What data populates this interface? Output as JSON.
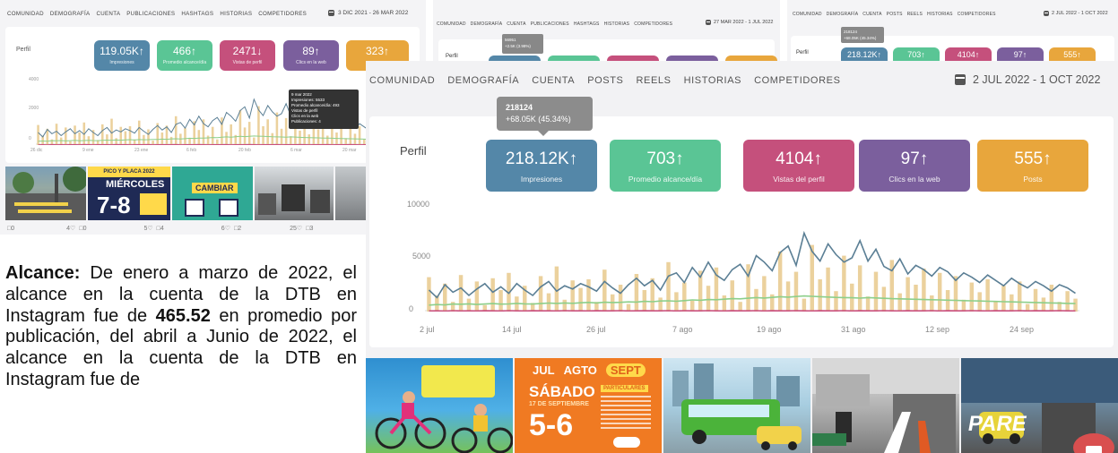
{
  "colors": {
    "blue": "#5487a8",
    "green": "#5ac595",
    "pink": "#c5507c",
    "purple": "#7b5f9d",
    "orange": "#e8a63c"
  },
  "panel1": {
    "nav": [
      "COMUNIDAD",
      "DEMOGRAFÍA",
      "CUENTA",
      "PUBLICACIONES",
      "HASHTAGS",
      "HISTORIAS",
      "COMPETIDORES"
    ],
    "date_range": "3 DIC 2021 - 26 MAR 2022",
    "perfil": "Perfil",
    "kpis": [
      {
        "value": "119.05K↑",
        "label": "Impresiones"
      },
      {
        "value": "466↑",
        "label": "Promedio alcance/día"
      },
      {
        "value": "2471↓",
        "label": "Vistas de perfil"
      },
      {
        "value": "89↑",
        "label": "Clics en la web"
      },
      {
        "value": "323↑",
        "label": ""
      }
    ],
    "y_ticks": [
      "4000",
      "2000",
      "0"
    ],
    "x_ticks": [
      "26 dic",
      "9 ene",
      "23 ene",
      "6 feb",
      "20 feb",
      "6 mar",
      "20 mar"
    ],
    "tooltip_title": "9 mar 2022",
    "tooltip_lines": [
      "Impresiones: 5533",
      "Promedio alcance/día: 493",
      "Vistas de perfil",
      "Clics en la web",
      "Publicaciones: 4"
    ],
    "post_stats": [
      "0",
      "4",
      "0",
      "5",
      "4",
      "6",
      "2",
      "25",
      "3"
    ],
    "post_thumb_texts": {
      "t2_title": "PICO Y PLACA 2022",
      "t2_day": "MIÉRCOLES",
      "t2_num": "7-8",
      "t3_word": "CAMBIAR"
    }
  },
  "panel2": {
    "nav": [
      "COMUNIDAD",
      "DEMOGRAFÍA",
      "CUENTA",
      "PUBLICACIONES",
      "HASHTAGS",
      "HISTORIAS",
      "COMPETIDORES"
    ],
    "date_range": "27 MAR 2022 - 1 JUL 2022",
    "tooltip": [
      "56951",
      "+2.5K (3.98%)"
    ],
    "perfil": "Perfil"
  },
  "panel3": {
    "nav": [
      "COMUNIDAD",
      "DEMOGRAFÍA",
      "CUENTA",
      "POSTS",
      "REELS",
      "HISTORIAS",
      "COMPETIDORES"
    ],
    "date_range": "2 JUL 2022 - 1 OCT 2022",
    "tooltip": [
      "218124",
      "+68.05K (45.34%)"
    ],
    "perfil": "Perfil",
    "kpis": [
      "218.12K↑",
      "703↑",
      "4104↑",
      "97↑",
      "555↑"
    ]
  },
  "panel4": {
    "nav": [
      "COMUNIDAD",
      "DEMOGRAFÍA",
      "CUENTA",
      "POSTS",
      "REELS",
      "HISTORIAS",
      "COMPETIDORES"
    ],
    "date_range": "2 JUL 2022 - 1 OCT 2022",
    "tooltip_value": "218124",
    "tooltip_delta": "+68.05K (45.34%)",
    "perfil": "Perfil",
    "kpis": [
      {
        "value": "218.12K↑",
        "label": "Impresiones"
      },
      {
        "value": "703↑",
        "label": "Promedio alcance/día"
      },
      {
        "value": "4104↑",
        "label": "Vistas del perfil"
      },
      {
        "value": "97↑",
        "label": "Clics en la web"
      },
      {
        "value": "555↑",
        "label": "Posts"
      }
    ],
    "y_ticks": [
      "10000",
      "5000",
      "0"
    ],
    "x_ticks": [
      "2 jul",
      "14 jul",
      "26 jul",
      "7 ago",
      "19 ago",
      "31 ago",
      "12 sep",
      "24 sep"
    ],
    "thumb_texts": {
      "t2_months": [
        "JUL",
        "AGTO",
        "SEPT"
      ],
      "t2_day": "SÁBADO",
      "t2_num": "5-6",
      "t2_sub": "17 DE SEPTIEMBRE",
      "t2_tag": "PARTICULARES",
      "t5_word": "PARE"
    }
  },
  "chart_data": {
    "type": "bar",
    "x": [
      "2 jul",
      "14 jul",
      "26 jul",
      "7 ago",
      "19 ago",
      "31 ago",
      "12 sep",
      "24 sep"
    ],
    "ylim": [
      0,
      10000
    ],
    "y_ticks": [
      0,
      5000,
      10000
    ],
    "series": [
      {
        "name": "",
        "kind": "bar",
        "color": "#e8c98c",
        "values": [
          3200,
          1500,
          2600,
          900,
          3400,
          1200,
          2800,
          600,
          3100,
          2000,
          3600,
          1400,
          2400,
          800,
          3300,
          1700,
          4200,
          1100,
          2900,
          2200,
          3000,
          900,
          3900,
          1600,
          2500,
          700,
          3500,
          2000,
          3100,
          1300,
          4600,
          1800,
          2700,
          1000,
          3800,
          2400,
          4100,
          1500,
          2900,
          900,
          4400,
          2100,
          3300,
          1600,
          5600,
          2800,
          3700,
          1200,
          6200,
          3000,
          4100,
          1900,
          5200,
          2600,
          4300,
          1400,
          3700,
          2300,
          4800,
          1700,
          3200,
          2500,
          4000,
          1500,
          3600,
          2000,
          3300,
          1100,
          2700,
          1800,
          3000,
          900,
          2400,
          1600,
          2800,
          700,
          2100,
          1300,
          2500,
          900,
          1900,
          1200
        ]
      },
      {
        "name": "",
        "kind": "line",
        "color": "#5b7f95",
        "values": [
          2000,
          1300,
          2500,
          1800,
          2200,
          1500,
          2100,
          2600,
          1800,
          2300,
          1700,
          2600,
          2000,
          1500,
          2300,
          2800,
          1900,
          2400,
          2100,
          2600,
          2300,
          1900,
          2800,
          2200,
          1700,
          2500,
          3100,
          2400,
          2900,
          2000,
          3300,
          3600,
          2700,
          4100,
          3200,
          4600,
          3400,
          2900,
          3900,
          4400,
          3300,
          5200,
          4600,
          3800,
          5500,
          6100,
          4300,
          7300,
          5600,
          4700,
          6300,
          5300,
          4600,
          5000,
          6600,
          4700,
          5800,
          4200,
          3800,
          4900,
          3500,
          4300,
          3900,
          3300,
          4100,
          3700,
          2900,
          3600,
          3200,
          2700,
          3400,
          2900,
          2400,
          3100,
          2600,
          2200,
          2800,
          2400,
          1900,
          2500,
          2200,
          1700
        ]
      },
      {
        "name": "",
        "kind": "line",
        "color": "#8ccf8a",
        "values": [
          600,
          650,
          620,
          700,
          680,
          720,
          660,
          700,
          740,
          690,
          710,
          760,
          720,
          700,
          740,
          790,
          760,
          800,
          770,
          820,
          850,
          800,
          870,
          840,
          860,
          900,
          880,
          950,
          920,
          980,
          1000,
          960,
          1020,
          1080,
          1050,
          1120,
          1100,
          1150,
          1200,
          1180,
          1240,
          1300,
          1260,
          1320,
          1380,
          1340,
          1400,
          1450,
          1420,
          1380,
          1350,
          1320,
          1300,
          1280,
          1250,
          1300,
          1270,
          1230,
          1200,
          1180,
          1160,
          1140,
          1120,
          1100,
          1080,
          1060,
          1040,
          1020,
          1000,
          980,
          960,
          940,
          920,
          900,
          880,
          860,
          840,
          820,
          800,
          780,
          760,
          740
        ]
      },
      {
        "name": "",
        "kind": "line",
        "color": "#c9507d",
        "values": [
          60,
          70,
          50,
          80,
          60,
          70,
          55,
          75,
          65,
          60,
          80,
          70,
          60,
          75,
          65,
          70,
          60,
          80,
          65,
          70,
          60,
          75,
          70,
          65,
          80,
          60,
          70,
          75,
          65,
          70,
          80,
          60,
          75,
          70,
          65,
          80,
          70,
          60,
          75,
          65,
          70,
          80,
          60,
          75,
          70,
          65,
          80,
          70,
          60,
          75,
          65,
          70,
          80,
          60,
          75,
          70,
          65,
          80,
          70,
          60,
          75,
          65,
          70,
          80,
          60,
          75,
          70,
          65,
          80,
          70,
          60,
          75,
          65,
          70,
          80,
          60,
          75,
          70,
          65,
          80,
          70,
          60
        ]
      }
    ]
  },
  "body_text": {
    "label": "Alcance:",
    "part1": " De enero a marzo de 2022, el alcance en la cuenta de la DTB en Instagram fue de ",
    "value": "465.52",
    "part2": " en promedio por publicación, del abril a Junio de 2022, el alcance en la cuenta de la DTB en Instagram fue de"
  }
}
